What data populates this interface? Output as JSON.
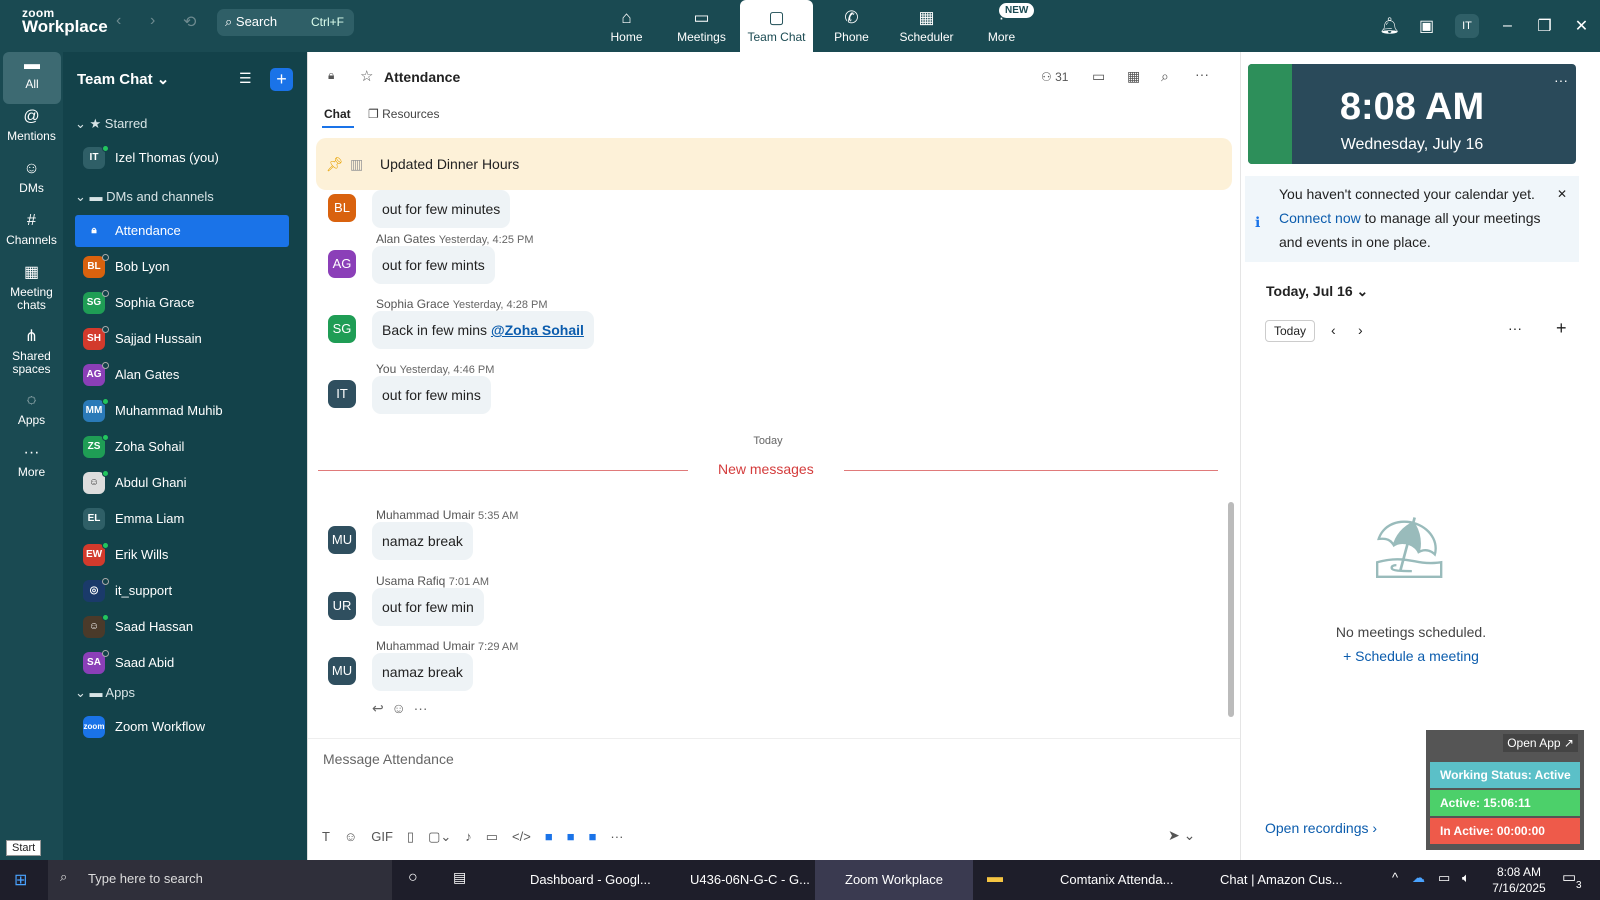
{
  "app": {
    "logo_line1": "zoom",
    "logo_line2": "Workplace",
    "search_label": "Search",
    "search_shortcut": "Ctrl+F",
    "avatar": "IT"
  },
  "nav_tabs": [
    {
      "label": "Home",
      "icon": "home-icon"
    },
    {
      "label": "Meetings",
      "icon": "video-icon"
    },
    {
      "label": "Team Chat",
      "icon": "chat-icon"
    },
    {
      "label": "Phone",
      "icon": "phone-icon"
    },
    {
      "label": "Scheduler",
      "icon": "calendar-icon"
    },
    {
      "label": "More",
      "icon": "more-icon",
      "badge": "NEW"
    }
  ],
  "rail": [
    "All",
    "Mentions",
    "DMs",
    "Channels",
    "Meeting chats",
    "Shared spaces",
    "Apps",
    "More"
  ],
  "sidebar": {
    "title": "Team Chat",
    "sections": {
      "starred": "Starred",
      "dms": "DMs and channels",
      "apps": "Apps"
    },
    "starred": [
      {
        "initials": "IT",
        "name": "Izel Thomas (you)"
      }
    ],
    "items": [
      {
        "initials": "",
        "name": "Attendance"
      },
      {
        "initials": "BL",
        "name": "Bob Lyon"
      },
      {
        "initials": "SG",
        "name": "Sophia Grace"
      },
      {
        "initials": "SH",
        "name": "Sajjad Hussain"
      },
      {
        "initials": "AG",
        "name": "Alan Gates"
      },
      {
        "initials": "MM",
        "name": "Muhammad Muhib"
      },
      {
        "initials": "ZS",
        "name": "Zoha Sohail"
      },
      {
        "initials": "",
        "name": "Abdul Ghani"
      },
      {
        "initials": "EL",
        "name": "Emma Liam"
      },
      {
        "initials": "EW",
        "name": "Erik Wills"
      },
      {
        "initials": "",
        "name": "it_support"
      },
      {
        "initials": "",
        "name": "Saad Hassan"
      },
      {
        "initials": "SA",
        "name": "Saad Abid"
      }
    ],
    "apps": [
      {
        "initials": "zoom",
        "name": "Zoom Workflow"
      }
    ]
  },
  "channel": {
    "name": "Attendance",
    "members": "31",
    "tab_chat": "Chat",
    "tab_resources": "Resources",
    "pinned": "Updated Dinner Hours"
  },
  "messages": [
    {
      "initials": "BL",
      "name": "",
      "time": "",
      "text": "out for few minutes"
    },
    {
      "initials": "AG",
      "name": "Alan Gates",
      "time": "Yesterday, 4:25 PM",
      "text": "out for few mints"
    },
    {
      "initials": "SG",
      "name": "Sophia Grace",
      "time": "Yesterday, 4:28 PM",
      "text": "Back in few mins ",
      "mention": "@Zoha Sohail"
    },
    {
      "initials": "IT",
      "name": "You",
      "time": "Yesterday, 4:46 PM",
      "text": "out for few mins"
    },
    {
      "initials": "MU",
      "name": "Muhammad Umair",
      "time": "5:35 AM",
      "text": "namaz break"
    },
    {
      "initials": "UR",
      "name": "Usama Rafiq",
      "time": "7:01 AM",
      "text": "out for few min"
    },
    {
      "initials": "MU",
      "name": "Muhammad Umair",
      "time": "7:29 AM",
      "text": "namaz break"
    }
  ],
  "divider_today": "Today",
  "new_messages": "New messages",
  "compose_placeholder": "Message Attendance",
  "right": {
    "time": "8:08 AM",
    "date": "Wednesday, July 16",
    "notice_pre": "You haven't connected your calendar yet. ",
    "notice_link": "Connect now",
    "notice_post": " to manage all your meetings and events in one place.",
    "day": "Today, Jul 16",
    "today_btn": "Today",
    "empty": "No meetings scheduled.",
    "schedule": "Schedule a meeting",
    "recordings": "Open recordings"
  },
  "status_widget": {
    "open_app": "Open App ↗",
    "working": "Working Status: Active",
    "active": "Active: 15:06:11",
    "inactive": "In Active: 00:00:00"
  },
  "taskbar": {
    "search": "Type here to search",
    "apps": [
      "Dashboard - Googl...",
      "U436-06N-G-C - G...",
      "Zoom Workplace",
      "",
      "Comtanix Attenda...",
      "Chat | Amazon Cus..."
    ],
    "time": "8:08 AM",
    "date": "7/16/2025",
    "notif": "3"
  },
  "tooltip": "Start"
}
